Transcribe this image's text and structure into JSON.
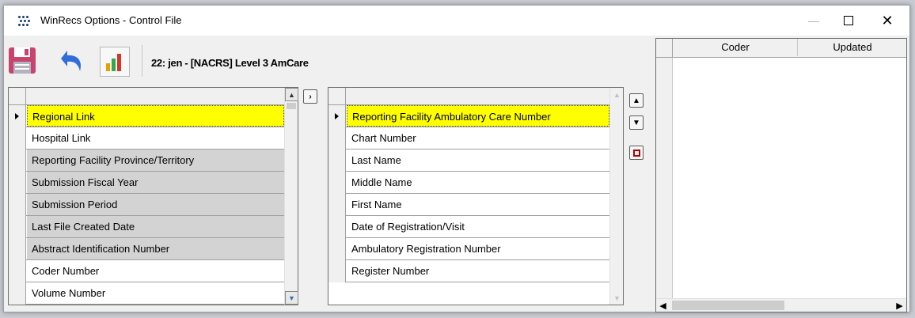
{
  "window": {
    "title": "WinRecs Options - Control File",
    "controls": {
      "minimize": "—",
      "maximize": "☐",
      "close": "✕"
    }
  },
  "toolbar": {
    "save_icon": "floppy-disk-icon",
    "undo_icon": "undo-arrow-icon",
    "chart_icon": "bar-chart-icon",
    "record_label": "22: jen - [NACRS] Level 3 AmCare"
  },
  "available_fields": {
    "items": [
      {
        "label": "Regional Link",
        "state": "selected"
      },
      {
        "label": "Hospital Link",
        "state": "normal"
      },
      {
        "label": "Reporting Facility Province/Territory",
        "state": "disabled"
      },
      {
        "label": "Submission Fiscal Year",
        "state": "disabled"
      },
      {
        "label": "Submission Period",
        "state": "disabled"
      },
      {
        "label": "Last File Created Date",
        "state": "disabled"
      },
      {
        "label": "Abstract Identification Number",
        "state": "disabled"
      },
      {
        "label": "Coder Number",
        "state": "normal"
      },
      {
        "label": "Volume Number",
        "state": "normal"
      }
    ]
  },
  "move_right_button": "›",
  "selected_fields": {
    "items": [
      {
        "label": "Reporting Facility Ambulatory Care Number",
        "state": "selected"
      },
      {
        "label": "Chart Number",
        "state": "normal"
      },
      {
        "label": "Last Name",
        "state": "normal"
      },
      {
        "label": "Middle Name",
        "state": "normal"
      },
      {
        "label": "First Name",
        "state": "normal"
      },
      {
        "label": "Date of Registration/Visit",
        "state": "normal"
      },
      {
        "label": "Ambulatory Registration Number",
        "state": "normal"
      },
      {
        "label": "Register Number",
        "state": "normal"
      }
    ]
  },
  "order_buttons": {
    "up": "⌃",
    "down": "⌄",
    "remove_icon": "stop-square-icon"
  },
  "history": {
    "columns": [
      "Coder",
      "Updated"
    ]
  },
  "colors": {
    "selected_row": "#ffff00",
    "disabled_row": "#d3d3d3",
    "stop_red": "#b00000"
  }
}
